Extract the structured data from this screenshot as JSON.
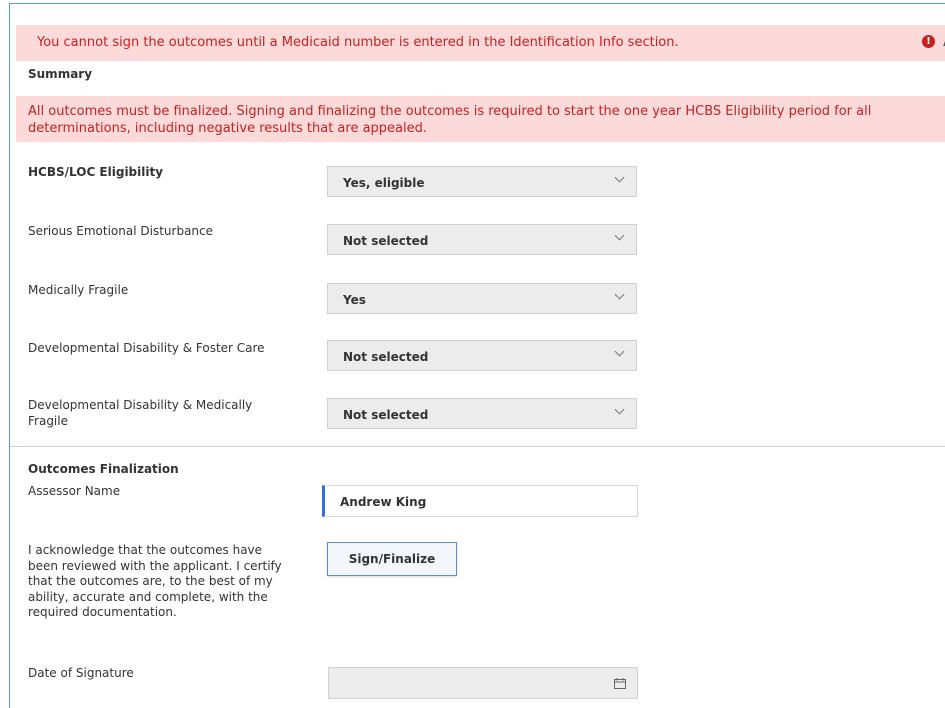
{
  "alerts": {
    "medicaid": "You cannot sign the outcomes until a Medicaid number is entered in the Identification Info section.",
    "error_icon": "!"
  },
  "summary": {
    "title": "Summary",
    "notice": "All outcomes must be finalized. Signing and finalizing the outcomes is required to start the one year HCBS Eligibility period for all determinations, including negative results that are appealed."
  },
  "fields": [
    {
      "label": "HCBS/LOC Eligibility",
      "value": "Yes, eligible"
    },
    {
      "label": "Serious Emotional Disturbance",
      "value": "Not selected"
    },
    {
      "label": "Medically Fragile",
      "value": "Yes"
    },
    {
      "label": "Developmental Disability & Foster Care",
      "value": "Not selected"
    },
    {
      "label": "Developmental Disability & Medically Fragile",
      "value": "Not selected"
    }
  ],
  "finalization": {
    "title": "Outcomes Finalization",
    "assessor_label": "Assessor Name",
    "assessor_value": "Andrew King",
    "acknowledgement": "I acknowledge that the outcomes have been reviewed with the applicant. I certify that the outcomes are, to the best of my ability, accurate and complete, with the required documentation.",
    "sign_button": "Sign/Finalize",
    "date_label": "Date of Signature",
    "date_value": ""
  },
  "colors": {
    "alert_bg": "#fcdada",
    "alert_text": "#c81f1f",
    "accent": "#2f6fde"
  }
}
